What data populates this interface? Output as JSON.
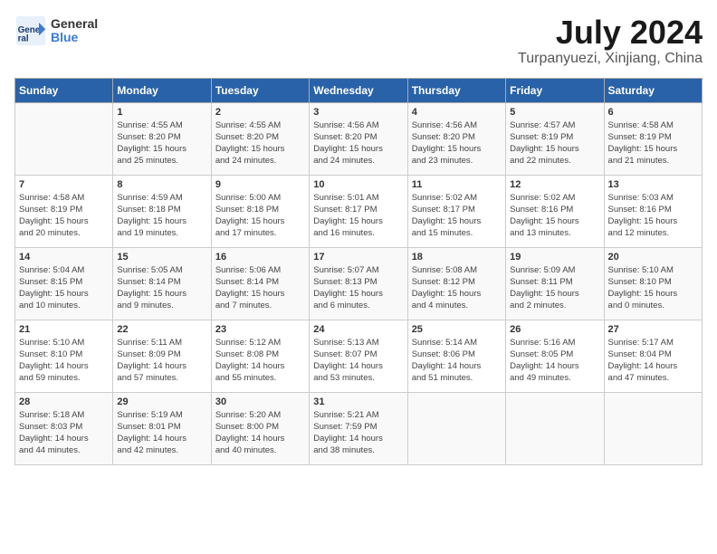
{
  "logo": {
    "line1": "General",
    "line2": "Blue"
  },
  "title": "July 2024",
  "subtitle": "Turpanyuezi, Xinjiang, China",
  "headers": [
    "Sunday",
    "Monday",
    "Tuesday",
    "Wednesday",
    "Thursday",
    "Friday",
    "Saturday"
  ],
  "weeks": [
    [
      {
        "day": "",
        "lines": []
      },
      {
        "day": "1",
        "lines": [
          "Sunrise: 4:55 AM",
          "Sunset: 8:20 PM",
          "Daylight: 15 hours",
          "and 25 minutes."
        ]
      },
      {
        "day": "2",
        "lines": [
          "Sunrise: 4:55 AM",
          "Sunset: 8:20 PM",
          "Daylight: 15 hours",
          "and 24 minutes."
        ]
      },
      {
        "day": "3",
        "lines": [
          "Sunrise: 4:56 AM",
          "Sunset: 8:20 PM",
          "Daylight: 15 hours",
          "and 24 minutes."
        ]
      },
      {
        "day": "4",
        "lines": [
          "Sunrise: 4:56 AM",
          "Sunset: 8:20 PM",
          "Daylight: 15 hours",
          "and 23 minutes."
        ]
      },
      {
        "day": "5",
        "lines": [
          "Sunrise: 4:57 AM",
          "Sunset: 8:19 PM",
          "Daylight: 15 hours",
          "and 22 minutes."
        ]
      },
      {
        "day": "6",
        "lines": [
          "Sunrise: 4:58 AM",
          "Sunset: 8:19 PM",
          "Daylight: 15 hours",
          "and 21 minutes."
        ]
      }
    ],
    [
      {
        "day": "7",
        "lines": [
          "Sunrise: 4:58 AM",
          "Sunset: 8:19 PM",
          "Daylight: 15 hours",
          "and 20 minutes."
        ]
      },
      {
        "day": "8",
        "lines": [
          "Sunrise: 4:59 AM",
          "Sunset: 8:18 PM",
          "Daylight: 15 hours",
          "and 19 minutes."
        ]
      },
      {
        "day": "9",
        "lines": [
          "Sunrise: 5:00 AM",
          "Sunset: 8:18 PM",
          "Daylight: 15 hours",
          "and 17 minutes."
        ]
      },
      {
        "day": "10",
        "lines": [
          "Sunrise: 5:01 AM",
          "Sunset: 8:17 PM",
          "Daylight: 15 hours",
          "and 16 minutes."
        ]
      },
      {
        "day": "11",
        "lines": [
          "Sunrise: 5:02 AM",
          "Sunset: 8:17 PM",
          "Daylight: 15 hours",
          "and 15 minutes."
        ]
      },
      {
        "day": "12",
        "lines": [
          "Sunrise: 5:02 AM",
          "Sunset: 8:16 PM",
          "Daylight: 15 hours",
          "and 13 minutes."
        ]
      },
      {
        "day": "13",
        "lines": [
          "Sunrise: 5:03 AM",
          "Sunset: 8:16 PM",
          "Daylight: 15 hours",
          "and 12 minutes."
        ]
      }
    ],
    [
      {
        "day": "14",
        "lines": [
          "Sunrise: 5:04 AM",
          "Sunset: 8:15 PM",
          "Daylight: 15 hours",
          "and 10 minutes."
        ]
      },
      {
        "day": "15",
        "lines": [
          "Sunrise: 5:05 AM",
          "Sunset: 8:14 PM",
          "Daylight: 15 hours",
          "and 9 minutes."
        ]
      },
      {
        "day": "16",
        "lines": [
          "Sunrise: 5:06 AM",
          "Sunset: 8:14 PM",
          "Daylight: 15 hours",
          "and 7 minutes."
        ]
      },
      {
        "day": "17",
        "lines": [
          "Sunrise: 5:07 AM",
          "Sunset: 8:13 PM",
          "Daylight: 15 hours",
          "and 6 minutes."
        ]
      },
      {
        "day": "18",
        "lines": [
          "Sunrise: 5:08 AM",
          "Sunset: 8:12 PM",
          "Daylight: 15 hours",
          "and 4 minutes."
        ]
      },
      {
        "day": "19",
        "lines": [
          "Sunrise: 5:09 AM",
          "Sunset: 8:11 PM",
          "Daylight: 15 hours",
          "and 2 minutes."
        ]
      },
      {
        "day": "20",
        "lines": [
          "Sunrise: 5:10 AM",
          "Sunset: 8:10 PM",
          "Daylight: 15 hours",
          "and 0 minutes."
        ]
      }
    ],
    [
      {
        "day": "21",
        "lines": [
          "Sunrise: 5:10 AM",
          "Sunset: 8:10 PM",
          "Daylight: 14 hours",
          "and 59 minutes."
        ]
      },
      {
        "day": "22",
        "lines": [
          "Sunrise: 5:11 AM",
          "Sunset: 8:09 PM",
          "Daylight: 14 hours",
          "and 57 minutes."
        ]
      },
      {
        "day": "23",
        "lines": [
          "Sunrise: 5:12 AM",
          "Sunset: 8:08 PM",
          "Daylight: 14 hours",
          "and 55 minutes."
        ]
      },
      {
        "day": "24",
        "lines": [
          "Sunrise: 5:13 AM",
          "Sunset: 8:07 PM",
          "Daylight: 14 hours",
          "and 53 minutes."
        ]
      },
      {
        "day": "25",
        "lines": [
          "Sunrise: 5:14 AM",
          "Sunset: 8:06 PM",
          "Daylight: 14 hours",
          "and 51 minutes."
        ]
      },
      {
        "day": "26",
        "lines": [
          "Sunrise: 5:16 AM",
          "Sunset: 8:05 PM",
          "Daylight: 14 hours",
          "and 49 minutes."
        ]
      },
      {
        "day": "27",
        "lines": [
          "Sunrise: 5:17 AM",
          "Sunset: 8:04 PM",
          "Daylight: 14 hours",
          "and 47 minutes."
        ]
      }
    ],
    [
      {
        "day": "28",
        "lines": [
          "Sunrise: 5:18 AM",
          "Sunset: 8:03 PM",
          "Daylight: 14 hours",
          "and 44 minutes."
        ]
      },
      {
        "day": "29",
        "lines": [
          "Sunrise: 5:19 AM",
          "Sunset: 8:01 PM",
          "Daylight: 14 hours",
          "and 42 minutes."
        ]
      },
      {
        "day": "30",
        "lines": [
          "Sunrise: 5:20 AM",
          "Sunset: 8:00 PM",
          "Daylight: 14 hours",
          "and 40 minutes."
        ]
      },
      {
        "day": "31",
        "lines": [
          "Sunrise: 5:21 AM",
          "Sunset: 7:59 PM",
          "Daylight: 14 hours",
          "and 38 minutes."
        ]
      },
      {
        "day": "",
        "lines": []
      },
      {
        "day": "",
        "lines": []
      },
      {
        "day": "",
        "lines": []
      }
    ]
  ]
}
